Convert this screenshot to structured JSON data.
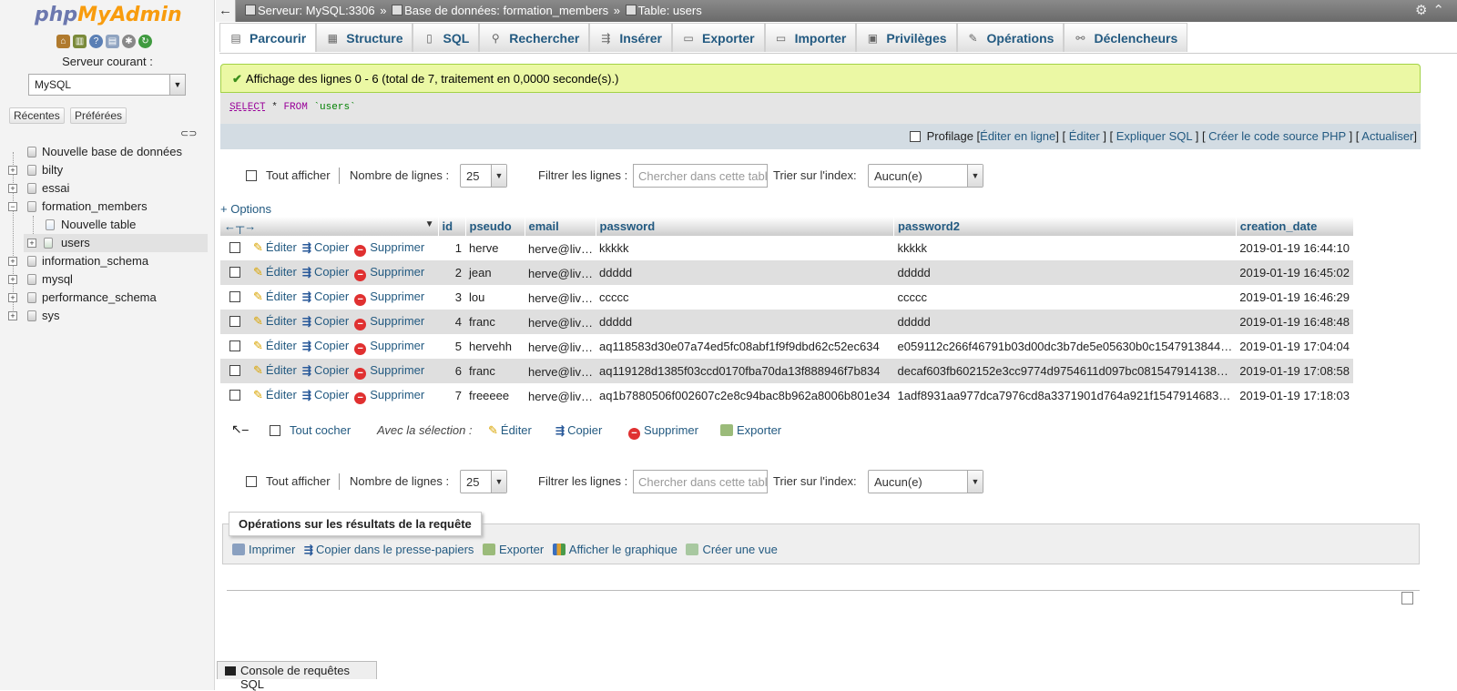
{
  "app": {
    "logo_php": "php",
    "logo_my": "MyAdmin"
  },
  "nav": {
    "quick_icons": [
      "home-icon",
      "db-icon",
      "help-icon",
      "docs-icon",
      "settings-icon",
      "reload-icon"
    ],
    "server_label": "Serveur courant :",
    "server_value": "MySQL",
    "tab_recent": "Récentes",
    "tab_favorites": "Préférées",
    "tree": [
      {
        "label": "Nouvelle base de données",
        "level": 0,
        "kind": "new"
      },
      {
        "label": "bilty",
        "level": 0,
        "kind": "db"
      },
      {
        "label": "essai",
        "level": 0,
        "kind": "db"
      },
      {
        "label": "formation_members",
        "level": 0,
        "kind": "db-open"
      },
      {
        "label": "Nouvelle table",
        "level": 1,
        "kind": "new"
      },
      {
        "label": "users",
        "level": 1,
        "kind": "table"
      },
      {
        "label": "information_schema",
        "level": 0,
        "kind": "db"
      },
      {
        "label": "mysql",
        "level": 0,
        "kind": "db"
      },
      {
        "label": "performance_schema",
        "level": 0,
        "kind": "db"
      },
      {
        "label": "sys",
        "level": 0,
        "kind": "db"
      }
    ]
  },
  "breadcrumb": {
    "server": "Serveur: MySQL:3306",
    "database": "Base de données: formation_members",
    "table": "Table: users",
    "separator": "»"
  },
  "tabs": [
    {
      "label": "Parcourir",
      "icon": "browse-icon",
      "active": true
    },
    {
      "label": "Structure",
      "icon": "structure-icon"
    },
    {
      "label": "SQL",
      "icon": "sql-icon"
    },
    {
      "label": "Rechercher",
      "icon": "search-icon"
    },
    {
      "label": "Insérer",
      "icon": "insert-icon"
    },
    {
      "label": "Exporter",
      "icon": "export-icon"
    },
    {
      "label": "Importer",
      "icon": "import-icon"
    },
    {
      "label": "Privilèges",
      "icon": "privileges-icon"
    },
    {
      "label": "Opérations",
      "icon": "operations-icon"
    },
    {
      "label": "Déclencheurs",
      "icon": "triggers-icon"
    }
  ],
  "message": {
    "success": "Affichage des lignes 0 - 6 (total de 7, traitement en 0,0000 seconde(s).)"
  },
  "sql": {
    "select": "SELECT",
    "star": "*",
    "from": "FROM",
    "table": "`users`"
  },
  "sql_links": {
    "profiling": "Profilage",
    "edit_inline": "Éditer en ligne",
    "edit": "Éditer",
    "explain": "Expliquer SQL",
    "php_code": "Créer le code source PHP",
    "refresh": "Actualiser"
  },
  "navigation": {
    "show_all": "Tout afficher",
    "rows_label": "Nombre de lignes :",
    "rows_value": "25",
    "filter_label": "Filtrer les lignes :",
    "filter_placeholder": "Chercher dans cette table",
    "sort_label": "Trier sur l'index:",
    "sort_value": "Aucun(e)"
  },
  "options_link": "+ Options",
  "table": {
    "columns": [
      "id",
      "pseudo",
      "email",
      "password",
      "password2",
      "creation_date"
    ],
    "actions": {
      "edit": "Éditer",
      "copy": "Copier",
      "delete": "Supprimer"
    },
    "rows": [
      [
        "1",
        "herve",
        "herve@live.fr",
        "kkkkk",
        "kkkkk",
        "2019-01-19 16:44:10"
      ],
      [
        "2",
        "jean",
        "herve@live.fr",
        "ddddd",
        "ddddd",
        "2019-01-19 16:45:02"
      ],
      [
        "3",
        "lou",
        "herve@live.fr",
        "ccccc",
        "ccccc",
        "2019-01-19 16:46:29"
      ],
      [
        "4",
        "franc",
        "herve@live.fr",
        "ddddd",
        "ddddd",
        "2019-01-19 16:48:48"
      ],
      [
        "5",
        "hervehh",
        "herve@live.fr",
        "aq118583d30e07a74ed5fc08abf1f9f9dbd62c52ec634",
        "e059112c266f46791b03d00dc3b7de5e05630b0c1547913844…",
        "2019-01-19 17:04:04"
      ],
      [
        "6",
        "franc",
        "herve@live.fr",
        "aq119128d1385f03ccd0170fba70da13f888946f7b834",
        "decaf603fb602152e3cc9774d9754611d097bc081547914138…",
        "2019-01-19 17:08:58"
      ],
      [
        "7",
        "freeeee",
        "herve@live.fr",
        "aq1b7880506f002607c2e8c94bac8b962a8006b801e34",
        "1adf8931aa977dca7976cd8a3371901d764a921f1547914683…",
        "2019-01-19 17:18:03"
      ]
    ]
  },
  "selection": {
    "check_all": "Tout cocher",
    "with_selected": "Avec la sélection :",
    "edit": "Éditer",
    "copy": "Copier",
    "delete": "Supprimer",
    "export": "Exporter"
  },
  "query_ops": {
    "title": "Opérations sur les résultats de la requête",
    "print": "Imprimer",
    "copy_clipboard": "Copier dans le presse-papiers",
    "export": "Exporter",
    "chart": "Afficher le graphique",
    "view": "Créer une vue"
  },
  "console": {
    "label": "Console de requêtes SQL"
  },
  "colors": {
    "link": "#235a81",
    "success_bg": "#ebf8a4",
    "row_alt": "#dfdfdf",
    "sql_bar": "#d3dce3"
  }
}
